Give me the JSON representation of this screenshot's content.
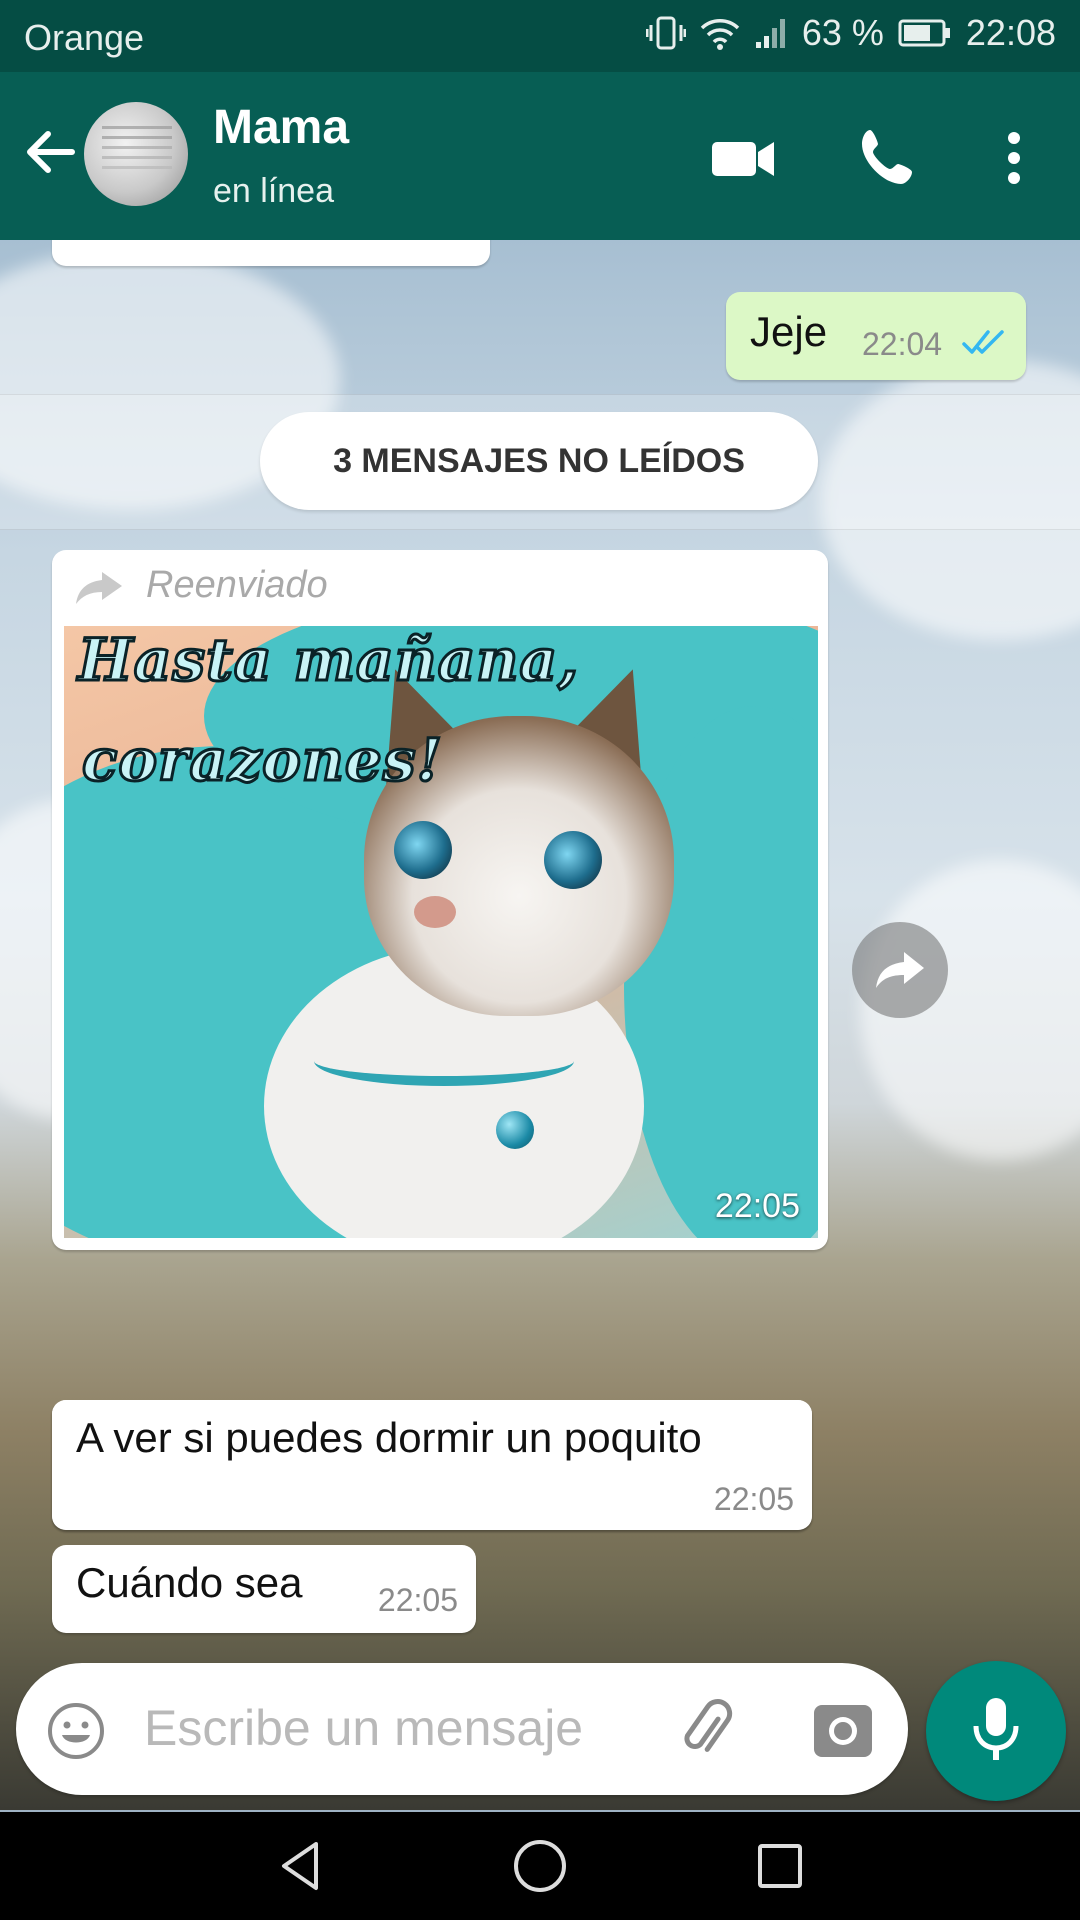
{
  "status_bar": {
    "carrier": "Orange",
    "battery_percent": "63 %",
    "clock": "22:08"
  },
  "header": {
    "contact_name": "Mama",
    "contact_status": "en línea",
    "icons": [
      "back-arrow-icon",
      "video-call-icon",
      "voice-call-icon",
      "more-options-icon"
    ]
  },
  "chat": {
    "outgoing": [
      {
        "text": "Jeje",
        "time": "22:04",
        "status": "read"
      }
    ],
    "unread_label": "3 MENSAJES NO LEÍDOS",
    "forwarded_image": {
      "forwarded_label": "Reenviado",
      "caption_line1": "Hasta mañana,",
      "caption_line2": "corazones!",
      "time": "22:05"
    },
    "incoming": [
      {
        "text": "A ver si puedes dormir un poquito",
        "time": "22:05"
      },
      {
        "text": "Cuándo sea",
        "time": "22:05"
      }
    ]
  },
  "composer": {
    "placeholder": "Escribe un mensaje",
    "icons": [
      "emoji-icon",
      "attach-icon",
      "camera-icon",
      "mic-icon"
    ]
  },
  "colors": {
    "header": "#075e54",
    "status_bar": "#054d44",
    "outgoing_bubble": "#dcf8c6",
    "accent": "#00897b",
    "read_ticks": "#34b7f1"
  }
}
